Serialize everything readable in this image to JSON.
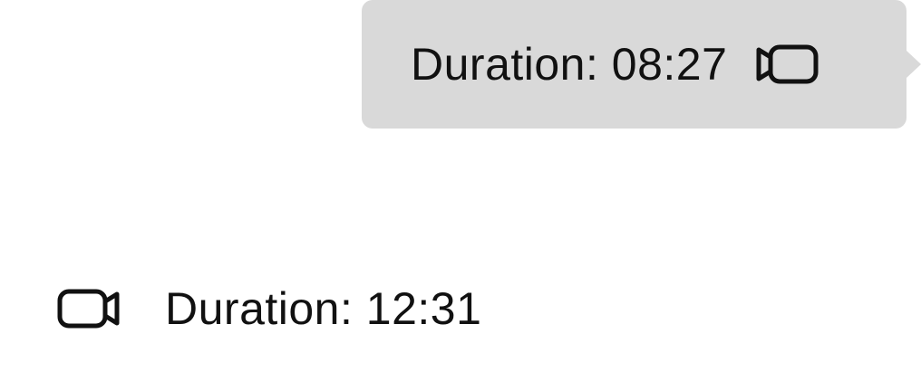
{
  "messages": [
    {
      "direction": "outgoing",
      "text": "Duration: 08:27",
      "icon": "video-camera-icon"
    },
    {
      "direction": "incoming",
      "text": "Duration: 12:31",
      "icon": "video-camera-icon"
    }
  ],
  "colors": {
    "bubble_outgoing": "#d9d9d9",
    "text": "#111111",
    "background": "#ffffff"
  }
}
